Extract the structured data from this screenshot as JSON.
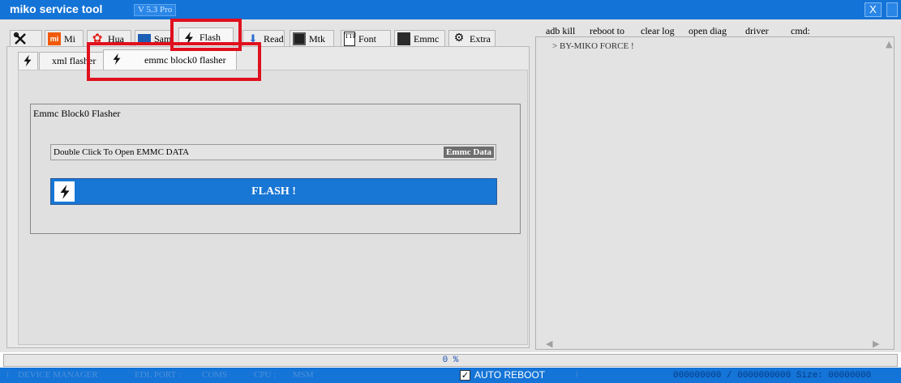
{
  "titlebar": {
    "app_title": "miko service tool",
    "version": "V 5.3 Pro",
    "close_label": "X"
  },
  "main_tabs": [
    {
      "label": "",
      "icon": "tools-icon"
    },
    {
      "label": "Mi",
      "icon": "mi-logo-icon"
    },
    {
      "label": "Hua",
      "icon": "huawei-logo-icon"
    },
    {
      "label": "Sam",
      "icon": "samsung-logo-icon"
    },
    {
      "label": "Flash",
      "icon": "lightning-icon",
      "active": true
    },
    {
      "label": "Read",
      "icon": "read-icon"
    },
    {
      "label": "Mtk",
      "icon": "chip-icon"
    },
    {
      "label": "Font",
      "icon": "font-file-icon"
    },
    {
      "label": "Emmc",
      "icon": "emmc-chip-icon"
    },
    {
      "label": "Extra",
      "icon": "extra-icon"
    }
  ],
  "sub_tabs": [
    {
      "label": "",
      "icon": "lightning-icon"
    },
    {
      "label": "xml flasher",
      "icon": ""
    },
    {
      "label": "emmc block0 flasher",
      "icon": "lightning-icon",
      "active": true
    }
  ],
  "emmc_panel": {
    "group_title": "Emmc Block0 Flasher",
    "field_text": "Double Click To Open EMMC DATA",
    "field_badge": "Emmc Data",
    "flash_button": "FLASH !"
  },
  "right_toolbar": [
    "adb kill",
    "reboot to",
    "clear log",
    "open diag",
    "driver",
    "cmd:"
  ],
  "log": {
    "lines": [
      "> BY-MIKO FORCE !"
    ]
  },
  "progress": {
    "text": "0 %",
    "value": 0
  },
  "statusbar": {
    "device_manager": "DEVICE MANAGER",
    "edl_port": "EDL PORT :",
    "coms": "COMS",
    "cpu": "CPU :",
    "msm": "MSM",
    "auto_reboot_label": "AUTO REBOOT",
    "auto_reboot_checked": true,
    "checkbox_mark": "✓",
    "separator": "⁞",
    "counter": "000000000 / 0000000000 Size: 00000000"
  },
  "colors": {
    "titlebar": "#1473d6",
    "flash_button": "#1876d4",
    "highlight": "#e0101e"
  }
}
